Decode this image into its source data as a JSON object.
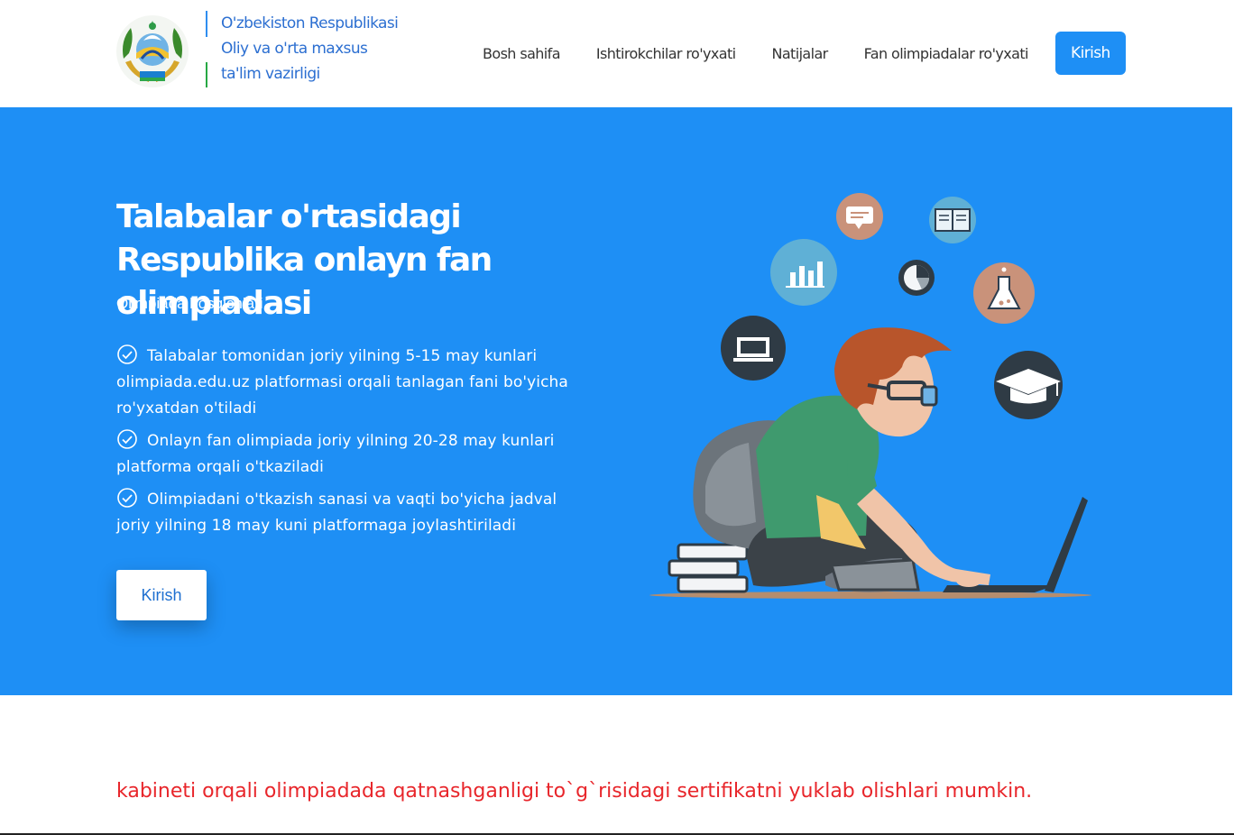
{
  "header": {
    "ministry_lines": [
      "O'zbekiston Respublikasi",
      "Oliy va o'rta maxsus",
      "ta'lim vazirligi"
    ],
    "nav": [
      "Bosh sahifa",
      "Ishtirokchilar ro'yxati",
      "Natijalar",
      "Fan olimpiadalar ro'yxati"
    ],
    "login_label": "Kirish"
  },
  "hero": {
    "title": "Talabalar o'rtasidagi Respublika onlayn fan olimpiadasi",
    "subtitle": "Olimpiada bosqichlari",
    "steps": [
      "Talabalar tomonidan joriy yilning 5-15 may kunlari olimpiada.edu.uz platformasi orqali tanlagan fani bo'yicha ro'yxatdan o'tiladi",
      "Onlayn fan olimpiada joriy yilning 20-28 may kunlari platforma orqali o'tkaziladi",
      "Olimpiadani o'tkazish sanasi va vaqti bo'yicha jadval joriy yilning 18 may kuni platformaga joylashtiriladi"
    ],
    "button_label": "Kirish"
  },
  "announcement": "kabineti orqali olimpiadada qatnashganligi to`g`risidagi sertifikatni yuklab olishlari mumkin.",
  "colors": {
    "primary": "#1e8ff5",
    "announcement": "#e8262b",
    "ministry_text": "#2c6fd1"
  },
  "icons": [
    "state-emblem",
    "check-circle-icon",
    "chat-icon",
    "book-icon",
    "bar-chart-icon",
    "pie-chart-icon",
    "flask-icon",
    "laptop-icon",
    "graduation-cap-icon"
  ]
}
